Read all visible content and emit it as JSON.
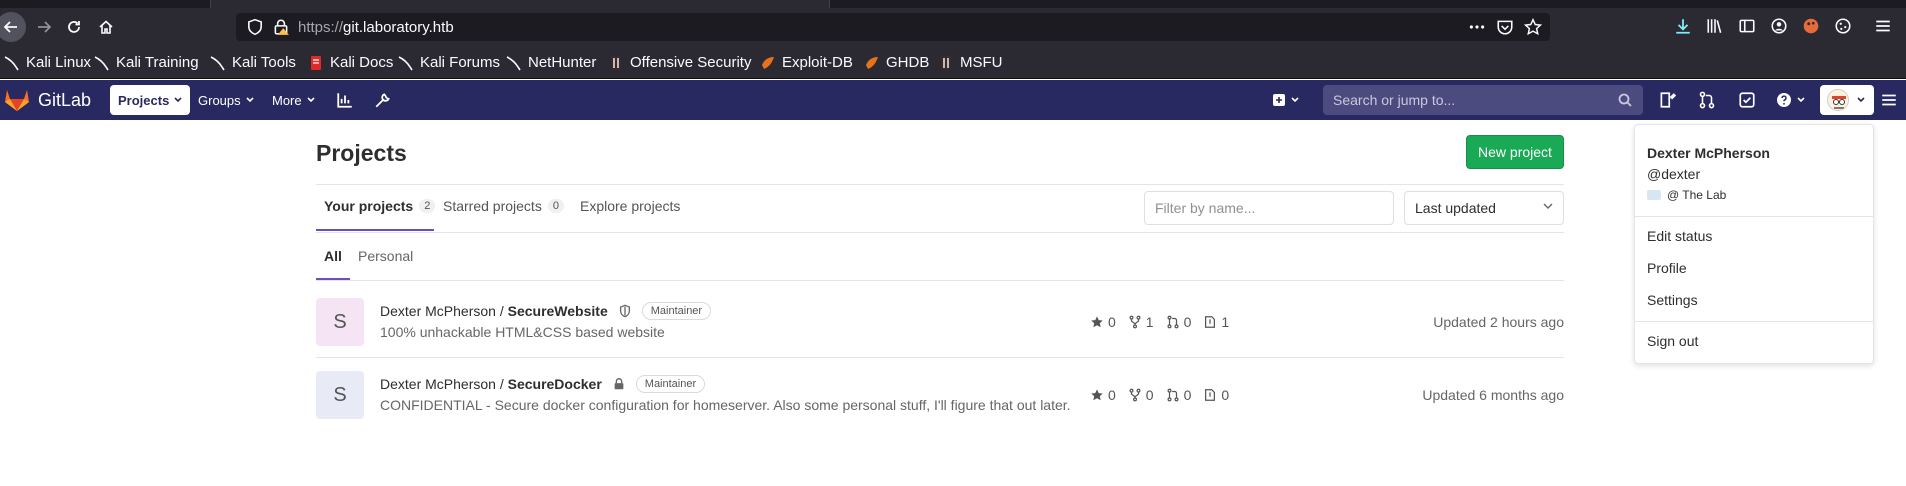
{
  "browser": {
    "url_protocol": "https://",
    "url_host_prefix": "git.",
    "url_host": "laboratory.htb",
    "bookmarks": [
      {
        "label": "Kali Linux",
        "icon": "kali-dragon-icon"
      },
      {
        "label": "Kali Training",
        "icon": "kali-dragon-icon"
      },
      {
        "label": "Kali Tools",
        "icon": "kali-dragon-icon"
      },
      {
        "label": "Kali Docs",
        "icon": "kali-docs-icon"
      },
      {
        "label": "Kali Forums",
        "icon": "kali-dragon-icon"
      },
      {
        "label": "NetHunter",
        "icon": "kali-dragon-icon"
      },
      {
        "label": "Offensive Security",
        "icon": "offsec-icon"
      },
      {
        "label": "Exploit-DB",
        "icon": "exploit-db-icon"
      },
      {
        "label": "GHDB",
        "icon": "exploit-db-icon"
      },
      {
        "label": "MSFU",
        "icon": "offsec-icon"
      }
    ]
  },
  "gitlab": {
    "brand": "GitLab",
    "nav": {
      "projects": "Projects",
      "groups": "Groups",
      "more": "More"
    },
    "search_placeholder": "Search or jump to...",
    "colors": {
      "header_bg": "#292961",
      "accent": "#6b4fbb",
      "success": "#1aaa55"
    }
  },
  "main": {
    "title": "Projects",
    "new_project_label": "New project",
    "tabs": [
      {
        "label": "Your projects",
        "count": "2"
      },
      {
        "label": "Starred projects",
        "count": "0"
      },
      {
        "label": "Explore projects"
      }
    ],
    "filter_placeholder": "Filter by name...",
    "sort_value": "Last updated",
    "subtabs": [
      "All",
      "Personal"
    ],
    "projects": [
      {
        "avatar_letter": "S",
        "namespace": "Dexter McPherson / ",
        "name": "SecureWebsite",
        "visibility_icon": "shield-icon",
        "role": "Maintainer",
        "description": "100% unhackable HTML&CSS based website",
        "stars": "0",
        "forks": "1",
        "merge_requests": "0",
        "issues": "1",
        "updated": "Updated 2 hours ago"
      },
      {
        "avatar_letter": "S",
        "namespace": "Dexter McPherson / ",
        "name": "SecureDocker",
        "visibility_icon": "lock-icon",
        "role": "Maintainer",
        "description": "CONFIDENTIAL - Secure docker configuration for homeserver. Also some personal stuff, I'll figure that out later.",
        "stars": "0",
        "forks": "0",
        "merge_requests": "0",
        "issues": "0",
        "updated": "Updated 6 months ago"
      }
    ]
  },
  "user_menu": {
    "name": "Dexter McPherson",
    "username": "@dexter",
    "status": "@ The Lab",
    "items": [
      "Edit status",
      "Profile",
      "Settings"
    ],
    "sign_out": "Sign out"
  }
}
